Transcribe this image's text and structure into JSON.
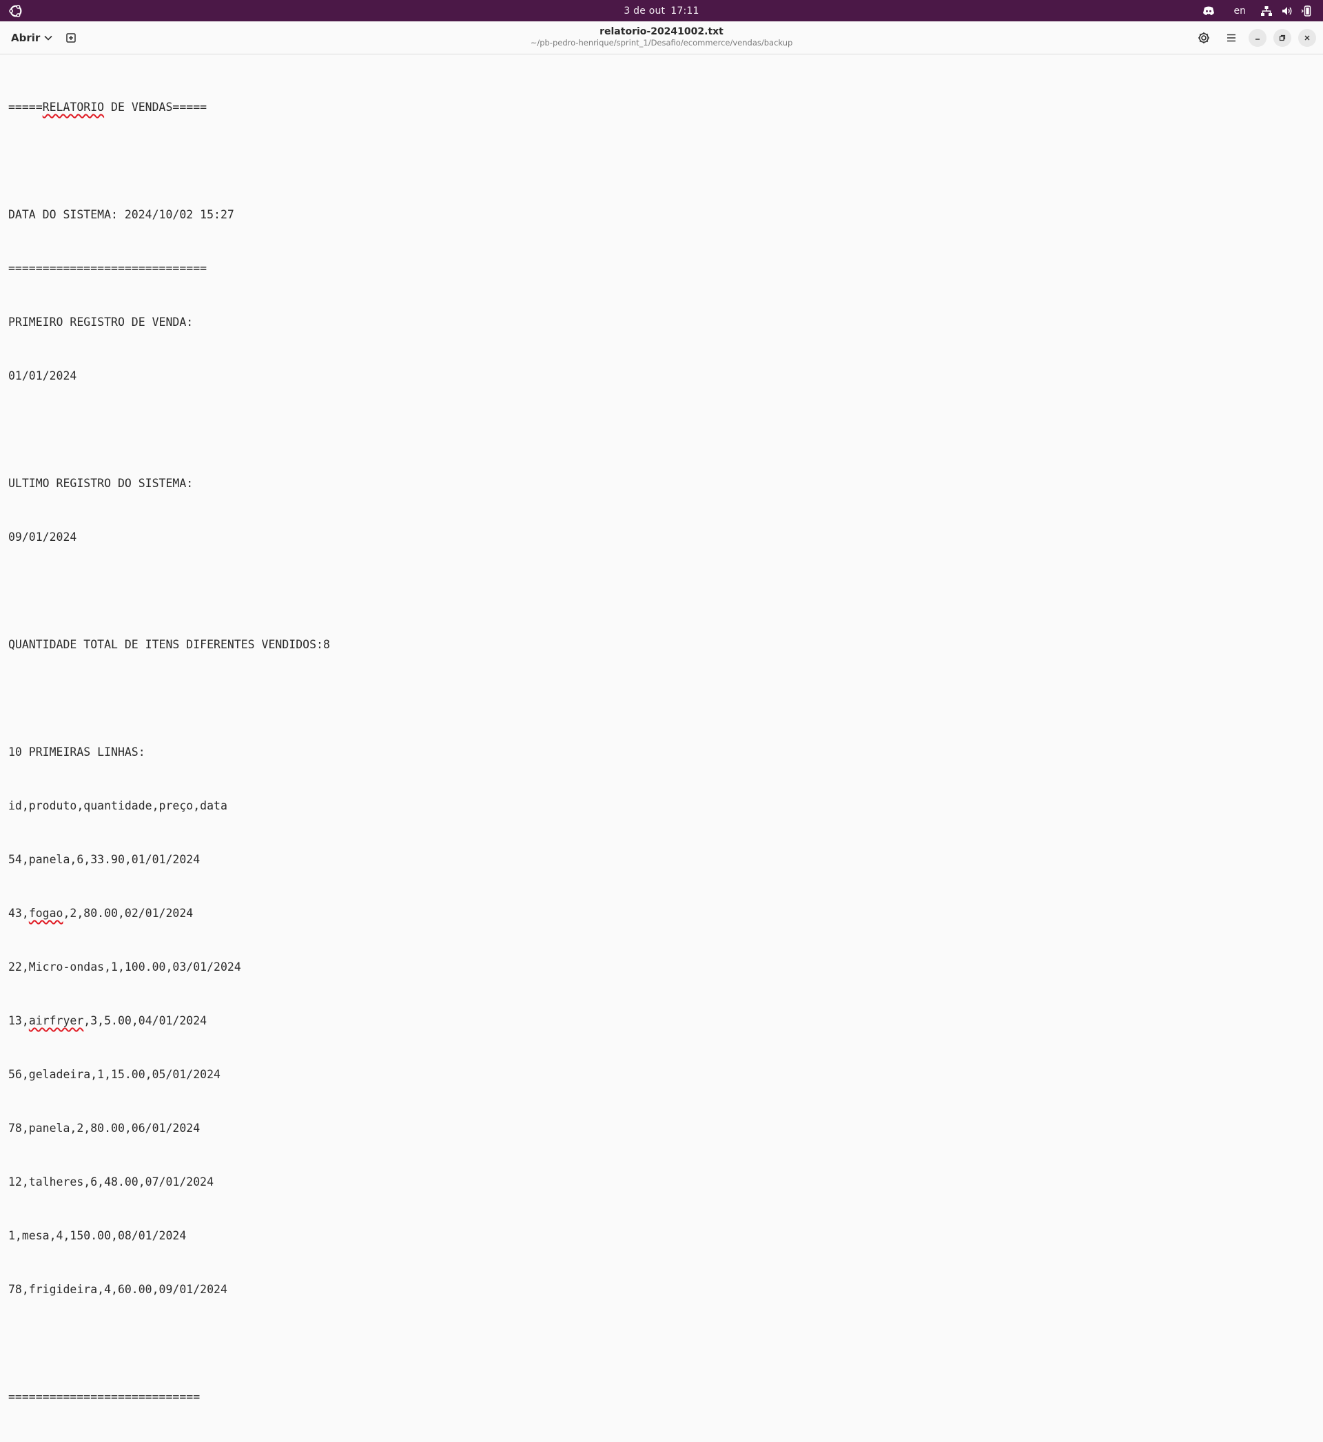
{
  "system_bar": {
    "date": "3 de out",
    "time": "17:11",
    "language": "en"
  },
  "header": {
    "open_label": "Abrir",
    "title": "relatorio-20241002.txt",
    "subtitle": "~/pb-pedro-henrique/sprint_1/Desafio/ecommerce/vendas/backup"
  },
  "document": {
    "lines": [
      [
        "=====",
        "RELATORIO",
        " DE VENDAS====="
      ],
      "",
      "DATA DO SISTEMA: 2024/10/02 15:27",
      "=============================",
      "PRIMEIRO REGISTRO DE VENDA:",
      "01/01/2024",
      "",
      "ULTIMO REGISTRO DO SISTEMA:",
      "09/01/2024",
      "",
      "QUANTIDADE TOTAL DE ITENS DIFERENTES VENDIDOS:8",
      "",
      "10 PRIMEIRAS LINHAS:",
      "id,produto,quantidade,preço,data",
      "54,panela,6,33.90,01/01/2024",
      [
        "43,",
        "fogao",
        ",2,80.00,02/01/2024"
      ],
      "22,Micro-ondas,1,100.00,03/01/2024",
      [
        "13,",
        "airfryer",
        ",3,5.00,04/01/2024"
      ],
      "56,geladeira,1,15.00,05/01/2024",
      "78,panela,2,80.00,06/01/2024",
      "12,talheres,6,48.00,07/01/2024",
      "1,mesa,4,150.00,08/01/2024",
      "78,frigideira,4,60.00,09/01/2024",
      "",
      "============================"
    ]
  },
  "colors": {
    "system_bar": "#4b1847",
    "spell_underline": "#e01b24",
    "editor_bg": "#fafafa"
  },
  "icons": {
    "logo": "ubuntu-logo-icon",
    "discord": "discord-icon",
    "network": "network-icon",
    "volume": "volume-icon",
    "battery": "battery-icon",
    "open_chevron": "chevron-down-icon",
    "new_document": "new-document-icon",
    "settings": "settings-icon",
    "menu": "hamburger-menu-icon",
    "minimize": "minimize-icon",
    "maximize": "restore-icon",
    "close": "close-icon"
  }
}
